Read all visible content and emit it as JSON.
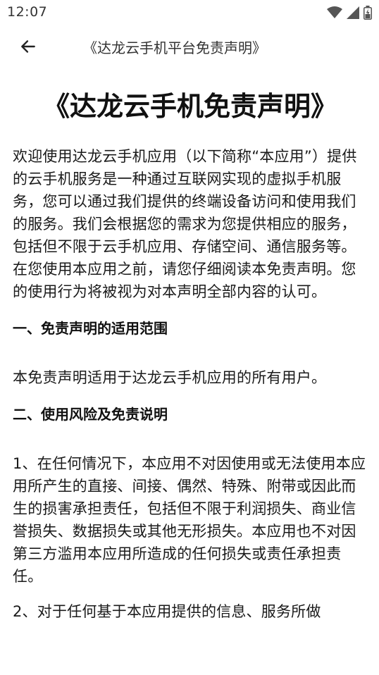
{
  "status_bar": {
    "time": "12:07",
    "icons": [
      "wifi-icon",
      "cellular-signal-icon",
      "battery-icon"
    ]
  },
  "app_bar": {
    "back_icon": "arrow-left-icon",
    "title": "《达龙云手机平台免责声明》"
  },
  "document": {
    "title": "《达龙云手机免责声明》",
    "intro": "欢迎使用达龙云手机应用（以下简称“本应用”）提供的云手机服务是一种通过互联网实现的虚拟手机服务，您可以通过我们提供的终端设备访问和使用我们的服务。我们会根据您的需求为您提供相应的服务，包括但不限于云手机应用、存储空间、通信服务等。在您使用本应用之前，请您仔细阅读本免责声明。您的使用行为将被视为对本声明全部内容的认可。",
    "section1_heading": "一、免责声明的适用范围",
    "section1_body": "本免责声明适用于达龙云手机应用的所有用户。",
    "section2_heading": "二、使用风险及免责说明",
    "section2_item1": "1、在任何情况下，本应用不对因使用或无法使用本应用所产生的直接、间接、偶然、特殊、附带或因此而生的损害承担责任，包括但不限于利润损失、商业信誉损失、数据损失或其他无形损失。本应用也不对因第三方滥用本应用所造成的任何损失或责任承担责任。",
    "section2_item2": "2、对于任何基于本应用提供的信息、服务所做"
  },
  "colors": {
    "background": "#ffffff",
    "text": "#1a1a1a",
    "status_icons": "#555555"
  }
}
